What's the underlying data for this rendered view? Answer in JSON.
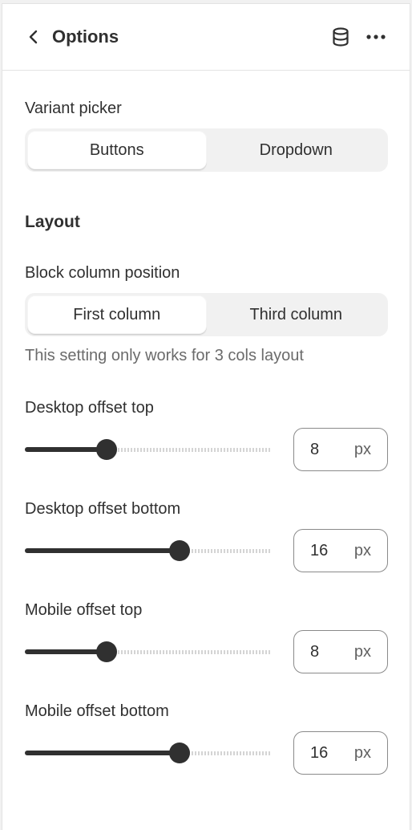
{
  "header": {
    "title": "Options",
    "back_icon": "chevron-left-icon",
    "database_icon": "database-icon",
    "more_icon": "more-horizontal-icon"
  },
  "variant_picker": {
    "label": "Variant picker",
    "options": [
      "Buttons",
      "Dropdown"
    ],
    "selected": "Buttons"
  },
  "layout": {
    "heading": "Layout",
    "block_column_position": {
      "label": "Block column position",
      "options": [
        "First column",
        "Third column"
      ],
      "selected": "First column",
      "help_text": "This setting only works for 3 cols layout"
    }
  },
  "sliders": [
    {
      "label": "Desktop offset top",
      "value": "8",
      "unit": "px",
      "fill": 0.33
    },
    {
      "label": "Desktop offset bottom",
      "value": "16",
      "unit": "px",
      "fill": 0.627
    },
    {
      "label": "Mobile offset top",
      "value": "8",
      "unit": "px",
      "fill": 0.33
    },
    {
      "label": "Mobile offset bottom",
      "value": "16",
      "unit": "px",
      "fill": 0.627
    }
  ],
  "colors": {
    "accent": "#303030",
    "border": "#e3e3e3",
    "segment_bg": "#f1f1f1",
    "helper_text": "#6b6b6b"
  }
}
